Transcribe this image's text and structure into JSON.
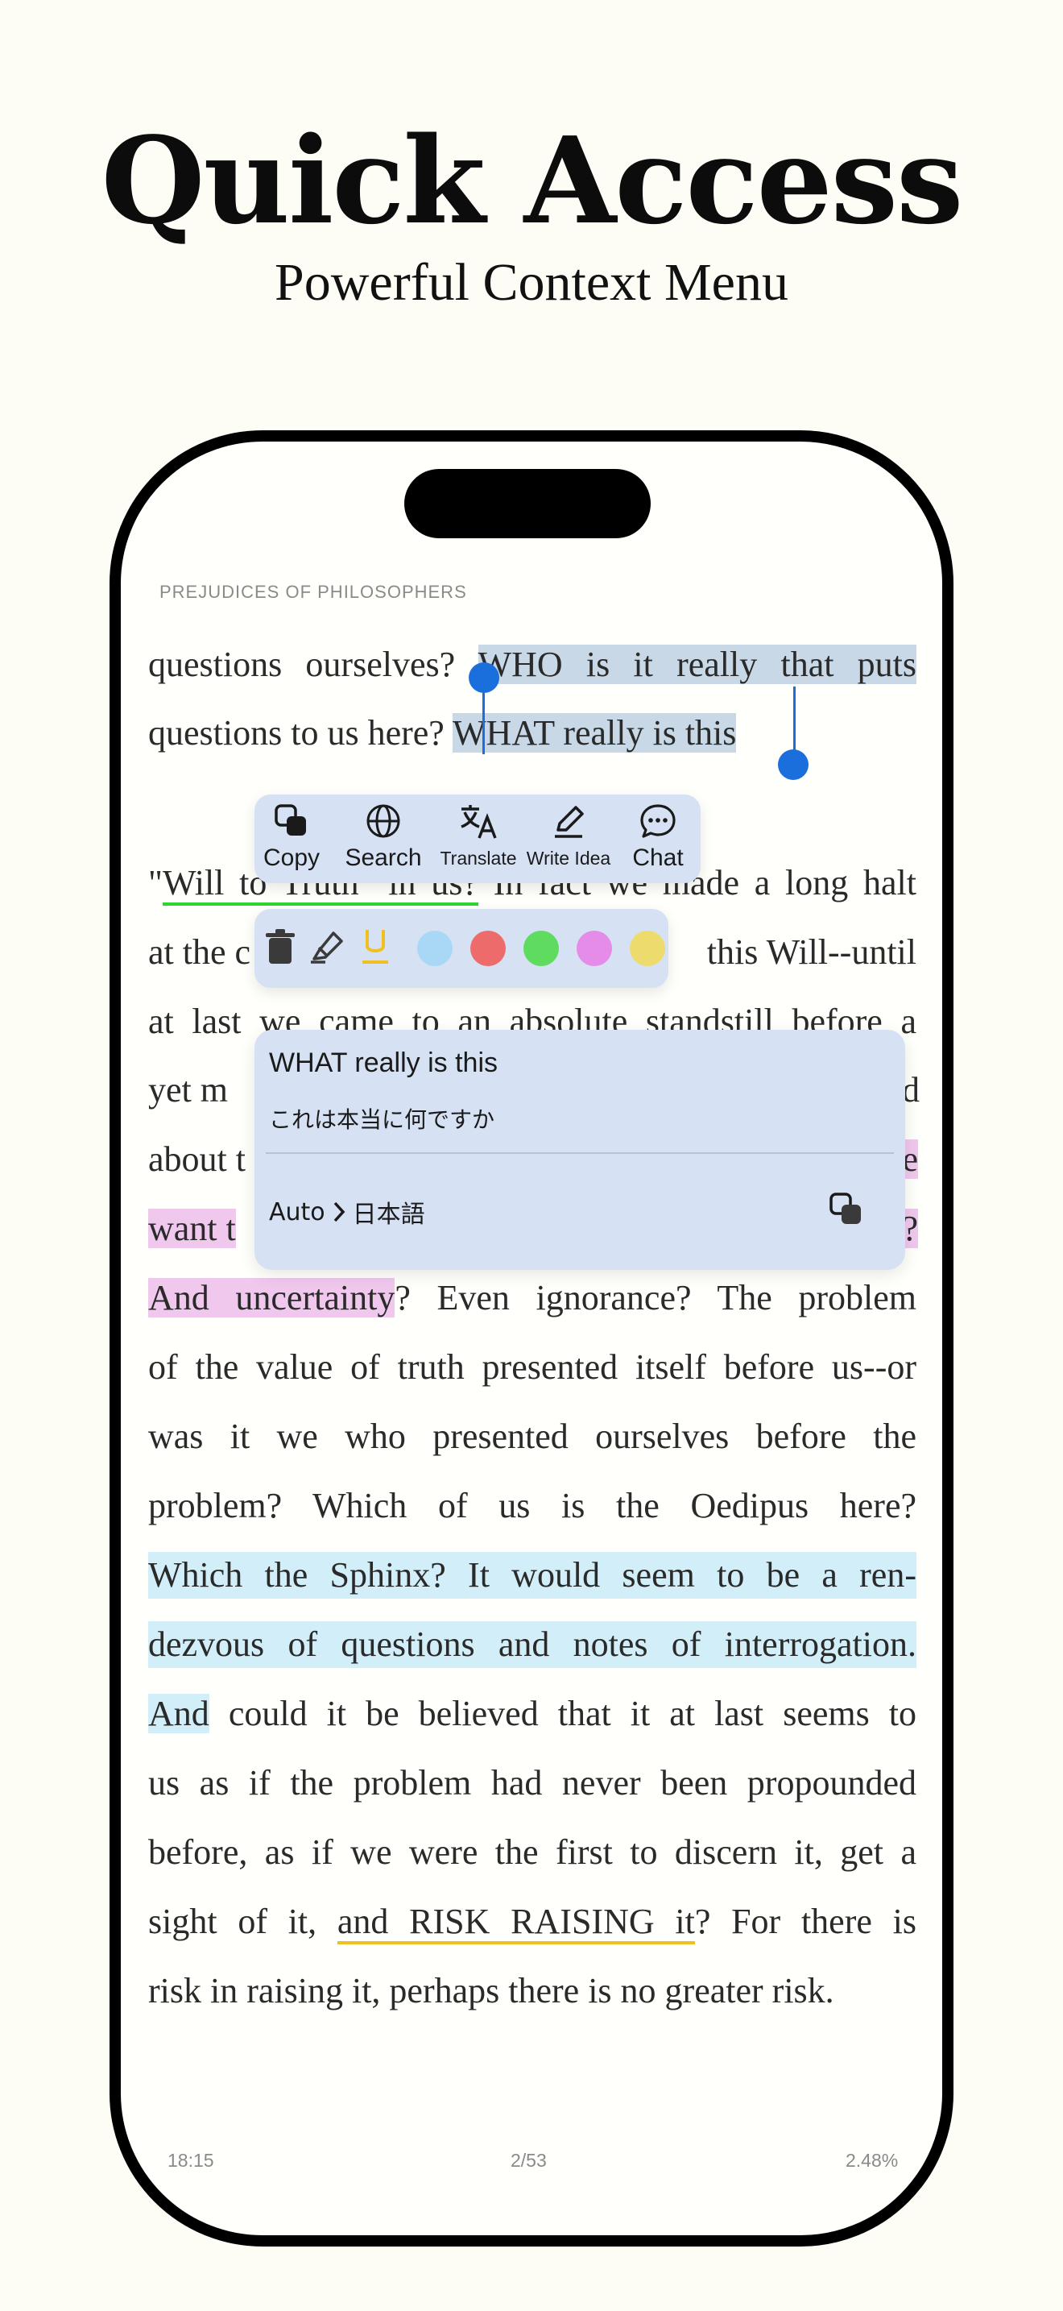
{
  "hero": {
    "title": "Quick Access",
    "subtitle": "Powerful Context Menu"
  },
  "book": {
    "header": "PREJUDICES OF PHILOSOPHERS",
    "lines": {
      "l1_before": "questions ourselves? ",
      "l1_selected": "WHO is it really that puts",
      "l2_before": "questions to us here? ",
      "l2_selected": "WHAT really is this",
      "l3_quote": "\"",
      "l3_underlined": "Will to Truth\" in us?",
      "l3_after": " In fact we made a long halt",
      "l4_start": "at the c",
      "l4_end": "this Will--until",
      "l5": "at last we came to an absolute standstill before a",
      "l6_start": "yet m",
      "l6_end": "d",
      "l7_start": "about t",
      "l7_end": "e",
      "l8_start": "want t",
      "l8_end": "?",
      "l9_highlight": "And uncertainty",
      "l9_after": "? Even ignorance? The problem",
      "l10": "of the value of truth presented itself before us--or",
      "l11": "was it we who presented ourselves before the",
      "l12": "problem? Which of us is the Oedipus here?",
      "l13": "Which the Sphinx? It would seem to be a ren-",
      "l14": "dezvous of questions and notes of interrogation.",
      "l15_highlight": "And",
      "l15_after": " could it be believed that it at last seems to",
      "l16": "us as if the problem had never been propounded",
      "l17": "before, as if we were the first to discern it, get a",
      "l18_before": "sight of it, ",
      "l18_underlined": "and RISK RAISING it",
      "l18_after": "? For there is",
      "l19": "risk in raising it, perhaps there is no greater risk."
    }
  },
  "context_menu": {
    "copy": "Copy",
    "search": "Search",
    "translate": "Translate",
    "write_idea": "Write Idea",
    "chat": "Chat"
  },
  "highlight_toolbar": {
    "colors": [
      "#a8d8f6",
      "#ee6b6b",
      "#5fdc5f",
      "#e48ce8",
      "#eedb6e"
    ],
    "underline_color": "#f0c020"
  },
  "translation": {
    "source": "WHAT really is this",
    "target": "これは本当に何ですか",
    "from_lang": "Auto",
    "to_lang": "日本語"
  },
  "footer": {
    "time": "18:15",
    "page": "2/53",
    "progress": "2.48%"
  }
}
